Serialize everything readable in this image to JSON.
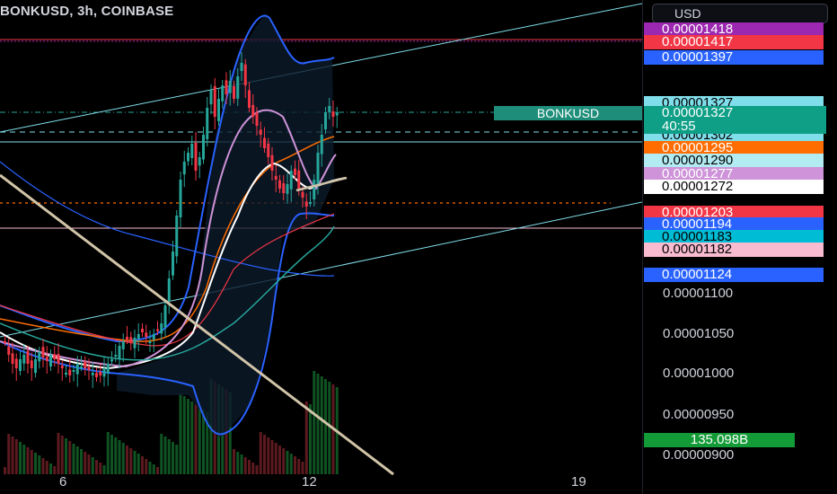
{
  "header": {
    "title": "BONKUSD, 3h, COINBASE",
    "currency": "USD"
  },
  "symbol_tag": "BONKUSD",
  "current_price": {
    "price": "0.00001327",
    "countdown": "40:55"
  },
  "price_labels": [
    {
      "text": "0.00001418",
      "bg": "#9c27b0",
      "fg": "#ffffff"
    },
    {
      "text": "0.00001417",
      "bg": "#f23645",
      "fg": "#ffffff"
    },
    {
      "text": "0.00001397",
      "bg": "#2962ff",
      "fg": "#ffffff"
    },
    {
      "text": "0.00001327",
      "bg": "#80deea",
      "fg": "#000000"
    },
    {
      "text": "0.00001302",
      "bg": "#80deea",
      "fg": "#000000"
    },
    {
      "text": "0.00001295",
      "bg": "#ff6d00",
      "fg": "#ffffff"
    },
    {
      "text": "0.00001290",
      "bg": "#b2ebf2",
      "fg": "#000000"
    },
    {
      "text": "0.00001277",
      "bg": "#ce93d8",
      "fg": "#ffffff"
    },
    {
      "text": "0.00001272",
      "bg": "#ffffff",
      "fg": "#000000"
    },
    {
      "text": "0.00001203",
      "bg": "#f23645",
      "fg": "#ffffff"
    },
    {
      "text": "0.00001194",
      "bg": "#2962ff",
      "fg": "#ffffff"
    },
    {
      "text": "0.00001183",
      "bg": "#00bcd4",
      "fg": "#000000"
    },
    {
      "text": "0.00001182",
      "bg": "#f8bbd0",
      "fg": "#000000"
    },
    {
      "text": "0.00001124",
      "bg": "#2962ff",
      "fg": "#ffffff"
    }
  ],
  "axis_ticks": [
    "0.00001100",
    "0.00001050",
    "0.00001000",
    "0.00000950",
    "0.00000900"
  ],
  "volume_label": "135.098B",
  "x_ticks": [
    "6",
    "12",
    "19"
  ],
  "colors": {
    "bull": "#26a69a",
    "bear": "#f23645",
    "ma_white": "#ffffff",
    "ma_orange": "#ff6d00",
    "ma_purple": "#ce93d8",
    "band": "#2962ff",
    "teal": "#26a69a",
    "trend": "#d1c4a8"
  }
}
